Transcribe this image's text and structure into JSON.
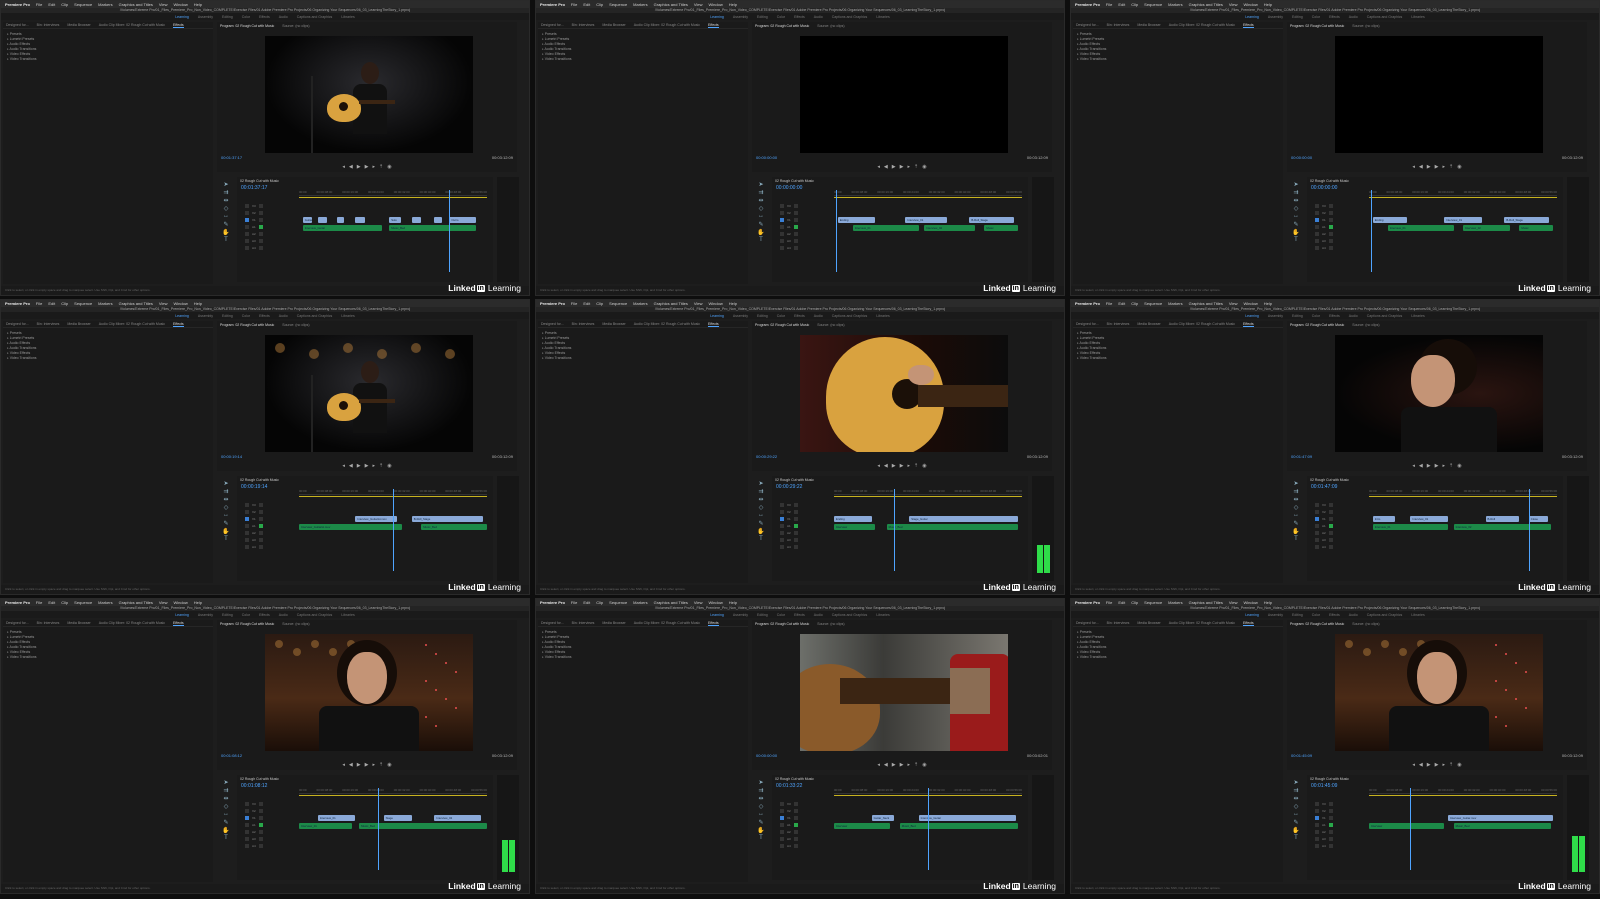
{
  "app": {
    "name": "Premiere Pro",
    "menus": [
      "File",
      "Edit",
      "Clip",
      "Sequence",
      "Markers",
      "Graphics and Titles",
      "View",
      "Window",
      "Help"
    ],
    "title": "/Volumes/Extreme Pro/01_Files_Premiere_Pro_Non_Video_COMPLETE/Exercise Files/01 Adobe Premiere Pro Projects/06 Organizing Your Sequences/06_03_LearningTheStory_1.prproj",
    "workspaces": [
      "Learning",
      "Assembly",
      "Editing",
      "Color",
      "Effects",
      "Audio",
      "Captions and Graphics",
      "Libraries"
    ],
    "active_workspace": "Learning"
  },
  "panels": {
    "left_tabs": [
      "Designed for...",
      "Bin: Interviews",
      "Media Browser",
      "Audio Clip Mixer: 02 Rough Cut with Music",
      "Effects"
    ],
    "effects_tree": [
      "Presets",
      "Lumetri Presets",
      "Audio Effects",
      "Audio Transitions",
      "Video Effects",
      "Video Transitions"
    ],
    "monitor_tabs": [
      "Program: 02 Rough Cut with Music",
      "Source: (no clips)"
    ],
    "sequence_name": "02 Rough Cut with Music",
    "ruler_ticks": [
      "00:00",
      "00:00:08:00",
      "00:00:16:00",
      "00:00:24:00",
      "00:00:32:00",
      "00:00:40:00",
      "00:00:48:00",
      "00:00:56:00"
    ],
    "tracks": [
      "V3",
      "V2",
      "V1",
      "A1",
      "A2",
      "A3",
      "A4"
    ],
    "status": "Click to select, or click in empty space and drag to marquee select. Use Shift, Opt, and Cmd for other options."
  },
  "brand": {
    "logo": "Linked",
    "logo_in": "in",
    "suffix": "Learning"
  },
  "tiles": [
    {
      "scene": "stage-guitarist",
      "program_tc": "00:01:37:17",
      "duration_tc": "00:03:12:09",
      "timeline_tc": "00:01:37:17",
      "playhead": 0.8,
      "meter": 0.0,
      "clips_v": [
        [
          "Guitar",
          0.02,
          0.05
        ],
        [
          "",
          0.1,
          0.05
        ],
        [
          "",
          0.2,
          0.04
        ],
        [
          "",
          0.3,
          0.05
        ],
        [
          "Solo",
          0.48,
          0.06
        ],
        [
          "",
          0.6,
          0.05
        ],
        [
          "",
          0.72,
          0.04
        ],
        [
          "Outro",
          0.8,
          0.14
        ]
      ],
      "clips_a": [
        [
          "Interview_Guitar",
          0.02,
          0.42
        ],
        [
          "Music_Bed",
          0.48,
          0.46
        ]
      ]
    },
    {
      "scene": "black",
      "program_tc": "00:00:00:00",
      "duration_tc": "00:03:12:09",
      "timeline_tc": "00:00:00:00",
      "playhead": 0.01,
      "meter": 0.0,
      "clips_v": [
        [
          "Ending",
          0.02,
          0.2
        ],
        [
          "Interview_01",
          0.38,
          0.22
        ],
        [
          "B-Roll_Stage",
          0.72,
          0.24
        ]
      ],
      "clips_a": [
        [
          "Interview_01",
          0.1,
          0.35
        ],
        [
          "Interview_02",
          0.48,
          0.27
        ],
        [
          "Music",
          0.8,
          0.18
        ]
      ]
    },
    {
      "scene": "black",
      "program_tc": "00:00:00:00",
      "duration_tc": "00:03:12:09",
      "timeline_tc": "00:00:00:00",
      "playhead": 0.01,
      "meter": 0.0,
      "clips_v": [
        [
          "Ending",
          0.02,
          0.18
        ],
        [
          "Interview_01",
          0.4,
          0.2
        ],
        [
          "B-Roll_Stage",
          0.72,
          0.24
        ]
      ],
      "clips_a": [
        [
          "Interview_01",
          0.1,
          0.35
        ],
        [
          "Interview_02",
          0.5,
          0.25
        ],
        [
          "Music",
          0.8,
          0.18
        ]
      ]
    },
    {
      "scene": "stage-wide",
      "program_tc": "00:00:19:14",
      "duration_tc": "00:03:12:09",
      "timeline_tc": "00:00:19:14",
      "playhead": 0.5,
      "meter": 0.0,
      "clips_v": [
        [
          "Interview_Guitarist.mov",
          0.3,
          0.22
        ],
        [
          "B-Roll_Stage",
          0.6,
          0.38
        ]
      ],
      "clips_a": [
        [
          "Interview_Guitarist.mov",
          0.0,
          0.55
        ],
        [
          "Music_Bed",
          0.65,
          0.35
        ]
      ]
    },
    {
      "scene": "guitar-closeup",
      "program_tc": "00:00:29:22",
      "duration_tc": "00:03:12:09",
      "timeline_tc": "00:00:29:22",
      "playhead": 0.32,
      "meter": 0.7,
      "clips_v": [
        [
          "Ending",
          0.0,
          0.2
        ],
        [
          "Stage_Guitar",
          0.4,
          0.58
        ]
      ],
      "clips_a": [
        [
          "Interview",
          0.0,
          0.22
        ],
        [
          "Music_Bed",
          0.28,
          0.7
        ]
      ]
    },
    {
      "scene": "profile-speaker",
      "program_tc": "00:01:47:09",
      "duration_tc": "00:03:12:09",
      "timeline_tc": "00:01:47:09",
      "playhead": 0.85,
      "meter": 0.0,
      "clips_v": [
        [
          "Intro",
          0.02,
          0.12
        ],
        [
          "Interview_01",
          0.22,
          0.2
        ],
        [
          "B-Roll",
          0.62,
          0.18
        ],
        [
          "Close",
          0.85,
          0.1
        ]
      ],
      "clips_a": [
        [
          "Interview_01",
          0.02,
          0.4
        ],
        [
          "Interview_02",
          0.45,
          0.52
        ]
      ]
    },
    {
      "scene": "interview-front",
      "program_tc": "00:01:08:12",
      "duration_tc": "00:03:12:09",
      "timeline_tc": "00:01:08:12",
      "playhead": 0.42,
      "meter": 0.8,
      "clips_v": [
        [
          "Interview_01",
          0.1,
          0.2
        ],
        [
          "Stage",
          0.45,
          0.15
        ],
        [
          "Interview_02",
          0.72,
          0.25
        ]
      ],
      "clips_a": [
        [
          "Interview_01",
          0.0,
          0.28
        ],
        [
          "Music_Bed",
          0.32,
          0.68
        ]
      ]
    },
    {
      "scene": "guitar-neck",
      "program_tc": "00:00:00:00",
      "duration_tc": "00:03:02:01",
      "timeline_tc": "00:01:33:22",
      "playhead": 0.5,
      "meter": 0.0,
      "clips_v": [
        [
          "Guitar_Neck",
          0.2,
          0.12
        ],
        [
          "Interview_Guitar",
          0.45,
          0.52
        ]
      ],
      "clips_a": [
        [
          "Interview",
          0.0,
          0.3
        ],
        [
          "Music_Bed",
          0.35,
          0.63
        ]
      ]
    },
    {
      "scene": "interview-front",
      "program_tc": "00:01:45:09",
      "duration_tc": "00:03:12:09",
      "timeline_tc": "00:01:45:09",
      "playhead": 0.22,
      "meter": 0.9,
      "clips_v": [
        [
          "Interview_Guitar.mov",
          0.42,
          0.56
        ]
      ],
      "clips_a": [
        [
          "Interview",
          0.0,
          0.4
        ],
        [
          "Music_Bed",
          0.45,
          0.52
        ]
      ]
    }
  ]
}
